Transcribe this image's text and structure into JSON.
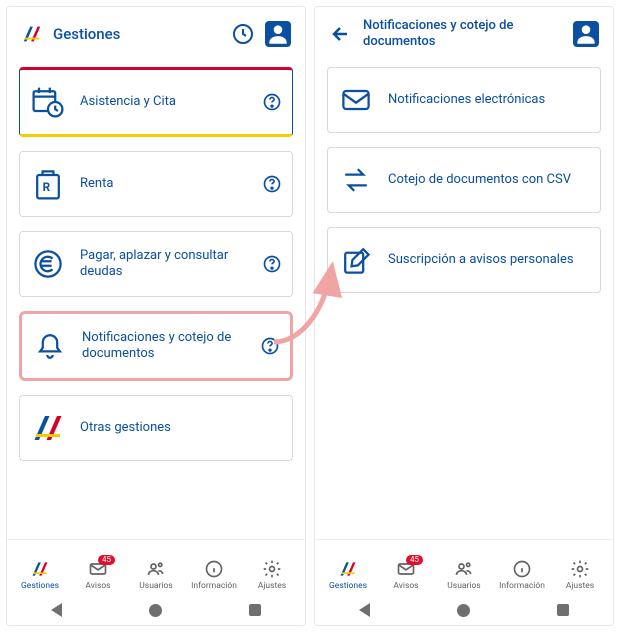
{
  "left": {
    "title": "Gestiones",
    "cards": [
      {
        "label": "Asistencia y Cita",
        "help": true
      },
      {
        "label": "Renta",
        "help": true
      },
      {
        "label": "Pagar, aplazar y consultar deudas",
        "help": true
      },
      {
        "label": "Notificaciones y cotejo de documentos",
        "help": true
      },
      {
        "label": "Otras gestiones",
        "help": false
      }
    ]
  },
  "right": {
    "title": "Notificaciones y cotejo de documentos",
    "cards": [
      {
        "label": "Notificaciones electrónicas"
      },
      {
        "label": "Cotejo de documentos con CSV"
      },
      {
        "label": "Suscripción a avisos personales"
      }
    ]
  },
  "nav": {
    "items": [
      {
        "label": "Gestiones"
      },
      {
        "label": "Avisos",
        "badge": "45"
      },
      {
        "label": "Usuarios"
      },
      {
        "label": "Información"
      },
      {
        "label": "Ajustes"
      }
    ]
  }
}
